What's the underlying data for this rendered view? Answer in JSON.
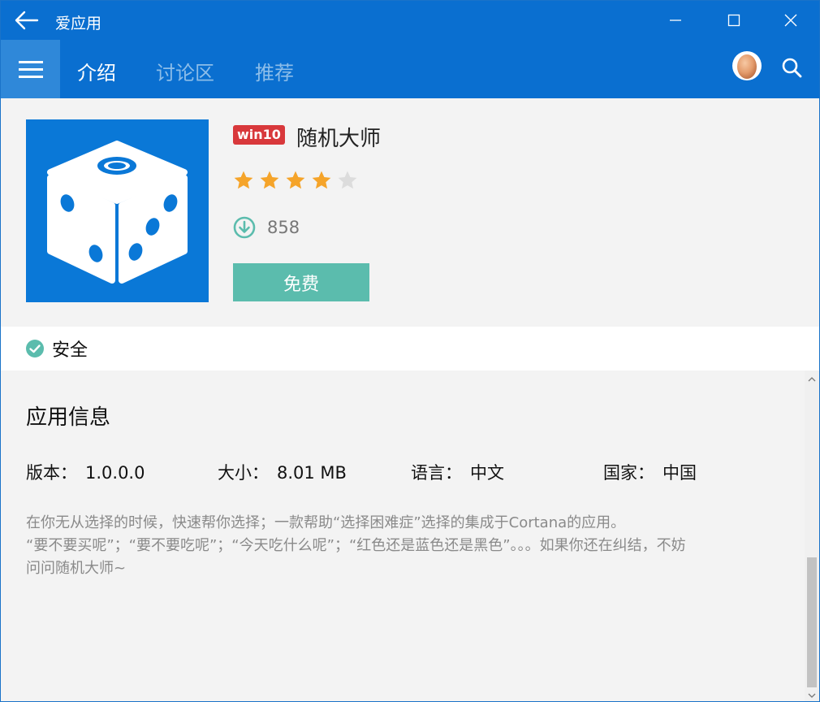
{
  "window": {
    "title": "爱应用",
    "accent": "#0a6fd0"
  },
  "tabs": [
    {
      "label": "介绍",
      "active": true
    },
    {
      "label": "讨论区",
      "active": false
    },
    {
      "label": "推荐",
      "active": false
    }
  ],
  "app": {
    "os_badge": "win10",
    "name": "随机大师",
    "rating": 4,
    "rating_max": 5,
    "downloads": "858",
    "button_label": "免费",
    "button_color": "#5bbcad"
  },
  "safety": {
    "label": "安全"
  },
  "info": {
    "title": "应用信息",
    "meta": [
      {
        "key": "版本：",
        "value": "1.0.0.0"
      },
      {
        "key": "大小：",
        "value": "8.01 MB"
      },
      {
        "key": "语言：",
        "value": "中文"
      },
      {
        "key": "国家：",
        "value": "中国"
      }
    ],
    "description": [
      "在你无从选择的时候，快速帮你选择；一款帮助“选择困难症”选择的集成于Cortana的应用。",
      "“要不要买呢”；“要不要吃呢”；“今天吃什么呢”；“红色还是蓝色还是黑色”。。。如果你还在纠结，不妨",
      "问问随机大师~"
    ]
  },
  "icons": {
    "back": "arrow-left-icon",
    "minimize": "minimize-icon",
    "maximize": "maximize-icon",
    "close": "close-icon",
    "menu": "hamburger-menu-icon",
    "avatar": "egg-avatar-icon",
    "search": "search-icon",
    "download": "download-icon",
    "safety": "check-circle-icon",
    "app": "dice-icon"
  }
}
